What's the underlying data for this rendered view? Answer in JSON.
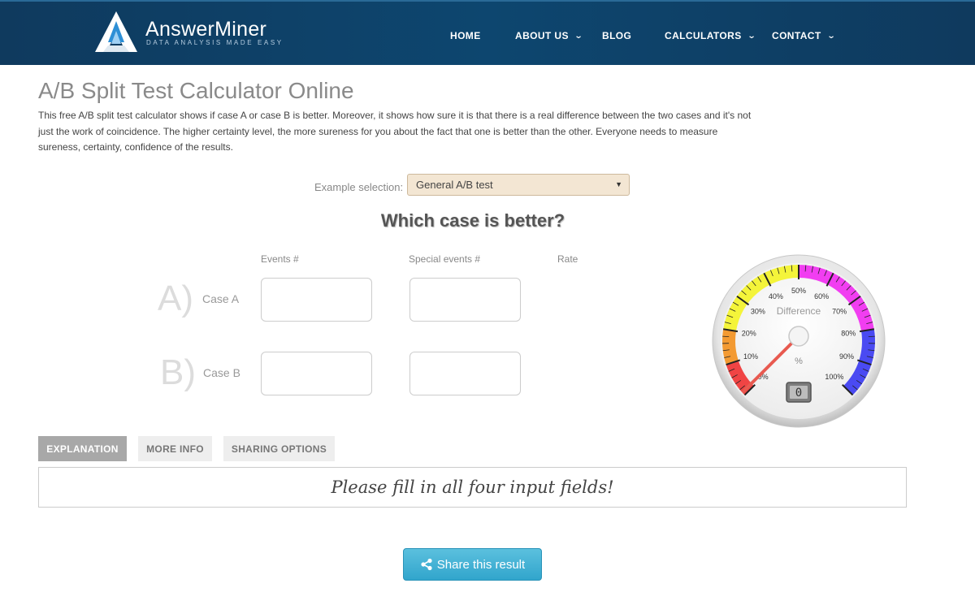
{
  "brand": {
    "name": "AnswerMiner",
    "tagline": "DATA ANALYSIS MADE EASY"
  },
  "nav": [
    {
      "label": "HOME"
    },
    {
      "label": "ABOUT US",
      "has_dropdown": true
    },
    {
      "label": "BLOG"
    },
    {
      "label": "CALCULATORS",
      "has_dropdown": true
    },
    {
      "label": "CONTACT",
      "has_dropdown": true
    }
  ],
  "page": {
    "title": "A/B Split Test Calculator Online",
    "intro": "This free A/B split test calculator shows if case A or case B is better. Moreover, it shows how sure it is that there is a real difference between the two cases and it's not just the work of coincidence. The higher certainty level, the more sureness for you about the fact that one is better than the other. Everyone needs to measure sureness, certainty, confidence of the results."
  },
  "example": {
    "label": "Example selection:",
    "selected": "General A/B test"
  },
  "heading": "Which case is better?",
  "columns": {
    "events": "Events #",
    "special": "Special events #",
    "rate": "Rate"
  },
  "cases": [
    {
      "letter": "A)",
      "label": "Case A",
      "events": "",
      "special": ""
    },
    {
      "letter": "B)",
      "label": "Case B",
      "events": "",
      "special": ""
    }
  ],
  "gauge": {
    "title": "Difference",
    "unit": "%",
    "ticks": [
      "0%",
      "10%",
      "20%",
      "30%",
      "40%",
      "50%",
      "60%",
      "70%",
      "80%",
      "90%",
      "100%"
    ],
    "value": 0,
    "readout": "0",
    "band_colors": {
      "red": "#f04444",
      "orange": "#f39a32",
      "yellow": "#f4f43a",
      "magenta": "#f13ef1",
      "blue": "#4a4af2"
    }
  },
  "tabs": [
    {
      "label": "EXPLANATION",
      "active": true
    },
    {
      "label": "MORE INFO",
      "active": false
    },
    {
      "label": "SHARING OPTIONS",
      "active": false
    }
  ],
  "message": "Please fill in all four input fields!",
  "share_button": {
    "label": "Share this result",
    "icon": "share-icon"
  }
}
